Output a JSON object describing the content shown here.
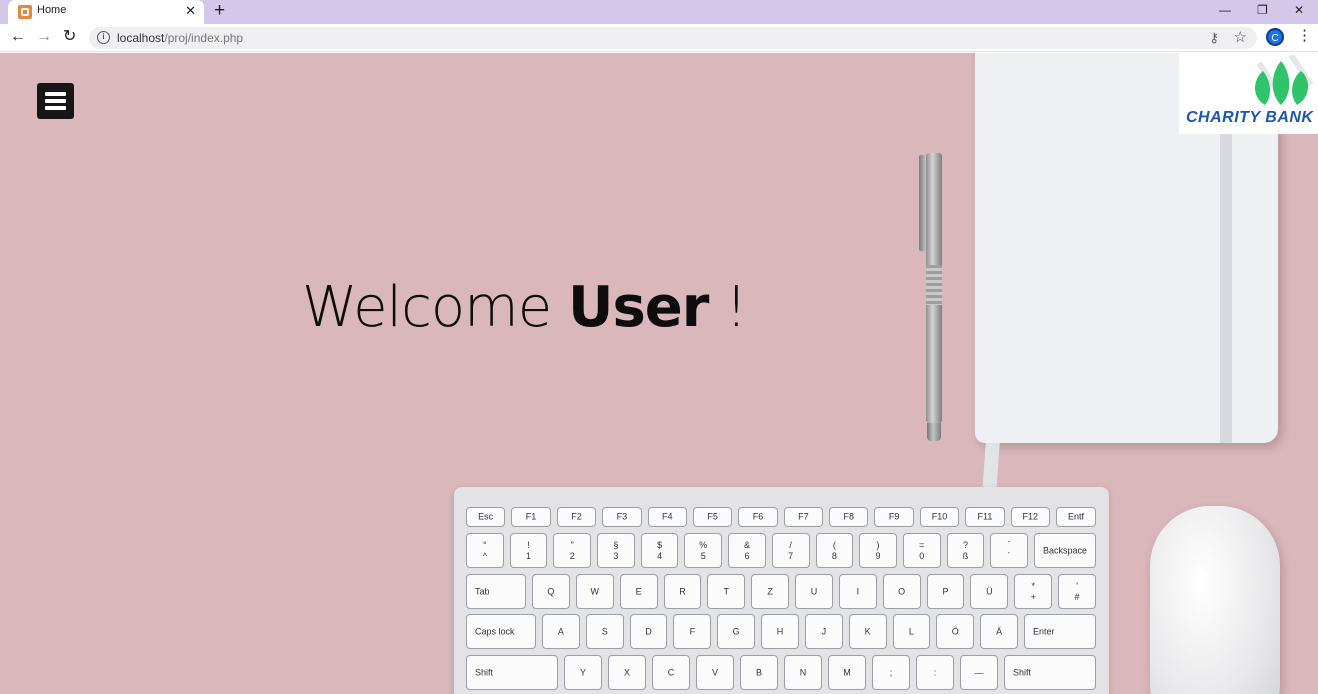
{
  "browser": {
    "tab_title": "Home",
    "tab_close": "✕",
    "new_tab": "+",
    "window_controls": {
      "minimize": "—",
      "restore": "❐",
      "close": "✕"
    },
    "nav": {
      "back": "←",
      "forward": "→",
      "reload": "↻"
    },
    "url_host": "localhost",
    "url_path": "/proj/index.php",
    "info_icon": "i",
    "key_icon": "⚷",
    "star_icon": "☆",
    "profile_initial": "C",
    "menu_icon": "⋮"
  },
  "page": {
    "welcome_prefix": "Welcome ",
    "welcome_name": "User",
    "welcome_suffix": " !",
    "logo_text": "CHARITY BANK",
    "background_color": "#dab7bb"
  },
  "keyboard": {
    "rows": [
      [
        "Esc",
        "F1",
        "F2",
        "F3",
        "F4",
        "F5",
        "F6",
        "F7",
        "F8",
        "F9",
        "F10",
        "F11",
        "F12",
        "Entf"
      ],
      [
        "°\n^",
        "!\n1",
        "\"\n2",
        "§\n3",
        "$\n4",
        "%\n5",
        "&\n6",
        "/\n7",
        "(\n8",
        ")\n9",
        "=\n0",
        "?\nß",
        "`\n´",
        "Backspace"
      ],
      [
        "Tab",
        "Q",
        "W",
        "E",
        "R",
        "T",
        "Z",
        "U",
        "I",
        "O",
        "P",
        "Ü",
        "*\n+",
        "'\n#"
      ],
      [
        "Caps lock",
        "A",
        "S",
        "D",
        "F",
        "G",
        "H",
        "J",
        "K",
        "L",
        "Ö",
        "Ä",
        "Enter"
      ],
      [
        "Shift",
        "Y",
        "X",
        "C",
        "V",
        "B",
        "N",
        "M",
        ";",
        ":",
        "—",
        "Shift"
      ]
    ]
  }
}
